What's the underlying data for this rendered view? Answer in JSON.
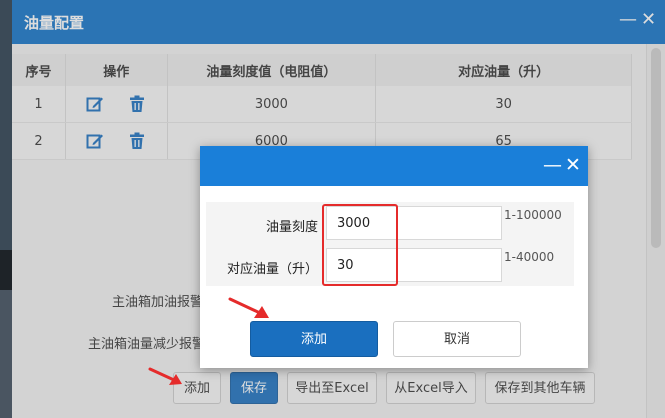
{
  "outer_dialog": {
    "title": "油量配置",
    "minimize_glyph": "—",
    "close_glyph": "✕",
    "table": {
      "headers": [
        "序号",
        "操作",
        "油量刻度值（电阻值）",
        "对应油量（升）"
      ],
      "rows": [
        {
          "index": "1",
          "scale": "3000",
          "fuel": "30"
        },
        {
          "index": "2",
          "scale": "6000",
          "fuel": "65"
        }
      ]
    },
    "labels": {
      "refuel_alarm": "主油箱加油报警",
      "reduce_alarm": "主油箱油量减少报警"
    },
    "buttons": {
      "add": "添加",
      "save": "保存",
      "export_excel": "导出至Excel",
      "import_excel": "从Excel导入",
      "save_other": "保存到其他车辆"
    }
  },
  "inner_dialog": {
    "minimize_glyph": "—",
    "close_glyph": "✕",
    "fields": {
      "scale_label": "油量刻度",
      "scale_value": "3000",
      "scale_hint": "1-100000",
      "fuel_label": "对应油量（升）",
      "fuel_value": "30",
      "fuel_hint": "1-40000"
    },
    "buttons": {
      "add": "添加",
      "cancel": "取消"
    }
  },
  "colors": {
    "title_bar": "#1273c9",
    "inner_title_bar": "#1a7fd9",
    "primary_button": "#1a6fbf",
    "highlight": "#e52b2b",
    "icon_blue": "#1a6fbf"
  }
}
